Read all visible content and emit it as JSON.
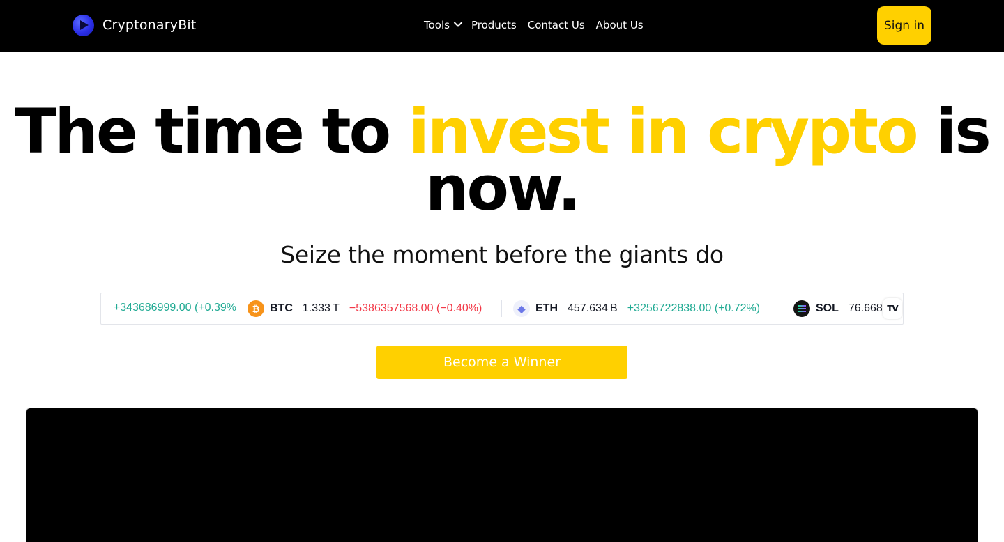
{
  "header": {
    "brand_name": "CryptonaryBit",
    "nav": [
      {
        "label": "Tools",
        "has_dropdown": true
      },
      {
        "label": "Products"
      },
      {
        "label": "Contact Us"
      },
      {
        "label": "About Us"
      }
    ],
    "signin_label": "Sign in"
  },
  "hero": {
    "title_part1": "The time to ",
    "title_highlight": "invest in crypto",
    "title_part2": " is now.",
    "subtitle": "Seize the moment before the giants do"
  },
  "ticker": {
    "partial_change": "+343686999.00 (+0.39%",
    "items": [
      {
        "symbol": "BTC",
        "icon": "bitcoin-icon",
        "price": "1.333 T",
        "change": "−5386357568.00 (−0.40%)",
        "direction": "down"
      },
      {
        "symbol": "ETH",
        "icon": "ethereum-icon",
        "price": "457.634 B",
        "change": "+3256722838.00 (+0.72%)",
        "direction": "up"
      },
      {
        "symbol": "SOL",
        "icon": "solana-icon",
        "price": "76.668",
        "change": "",
        "direction": "up"
      }
    ],
    "badge": "TV"
  },
  "cta_label": "Become a Winner",
  "colors": {
    "accent": "#ffd000",
    "header_bg": "#000000",
    "up": "#22ab94",
    "down": "#f23645"
  }
}
